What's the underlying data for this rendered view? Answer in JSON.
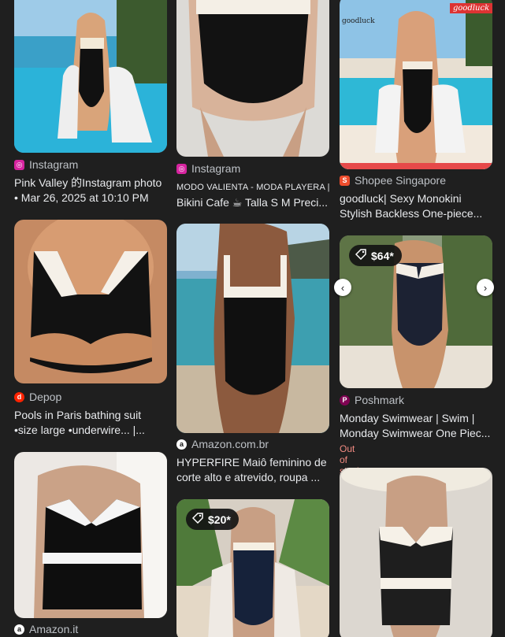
{
  "cards": [
    {
      "source": "Instagram",
      "title": [
        "Pink Valley 的Instagram photo",
        "• Mar 26, 2025 at 10:10 PM"
      ]
    },
    {
      "source": "Instagram",
      "title_small": "MODO VALIENTA - MODA PLAYERA |",
      "title": [
        "Bikini Cafe ☕ Talla S M Preci..."
      ]
    },
    {
      "source": "Shopee Singapore",
      "watermark": "goodluck",
      "watermark_small": "goodluck",
      "title": [
        "goodluck| Sexy Monokini",
        "Stylish Backless One-piece..."
      ]
    },
    {
      "source": "Depop",
      "title": [
        "Pools in Paris bathing suit",
        "•size large •underwire... |..."
      ]
    },
    {
      "source": "Amazon.com.br",
      "title": [
        "HYPERFIRE Maiô feminino de",
        "corte alto e atrevido, roupa ..."
      ]
    },
    {
      "source": "Poshmark",
      "price": "$64*",
      "title": [
        "Monday Swimwear | Swim |",
        "Monday Swimwear One Piec..."
      ],
      "stock": "Out of stock"
    },
    {
      "source": "Amazon.it"
    },
    {
      "price": "$20*"
    },
    {}
  ],
  "icons": {
    "price_tag": "tag-icon",
    "next_arrow": "chevron-right-icon",
    "prev_arrow": "chevron-left-icon"
  },
  "colors": {
    "background": "#1f1f1f",
    "instagram": "#d6249f",
    "shopee": "#ee4d2d",
    "depop": "#ff2300",
    "amazon": "#ffffff",
    "poshmark": "#7f0353",
    "out_of_stock": "#f28b82"
  }
}
